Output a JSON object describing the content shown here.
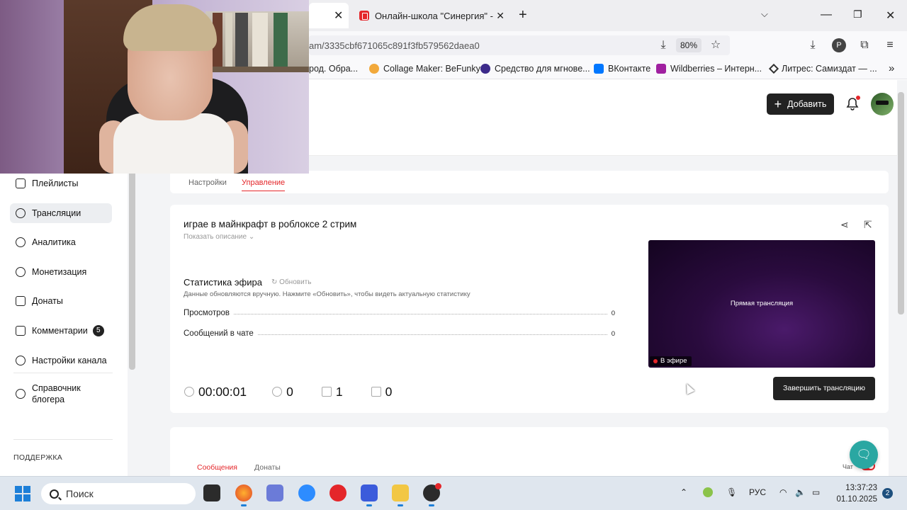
{
  "browser": {
    "tab_title": "Онлайн-школа \"Синергия\" - д",
    "url": "am/3335cbf671065c891f3fb579562daea0",
    "zoom": "80%",
    "bookmarks": [
      "род. Обра...",
      "Collage Maker: BeFunky",
      "Средство для мгнове...",
      "ВКонтакте",
      "Wildberries – Интерн...",
      "Литрес: Самиздат — ..."
    ]
  },
  "header": {
    "add_label": "Добавить"
  },
  "sidebar": {
    "items": [
      {
        "label": "Плейлисты",
        "icon": "playlist-icon"
      },
      {
        "label": "Трансляции",
        "icon": "broadcast-icon"
      },
      {
        "label": "Аналитика",
        "icon": "analytics-icon"
      },
      {
        "label": "Монетизация",
        "icon": "ruble-icon"
      },
      {
        "label": "Донаты",
        "icon": "donate-icon"
      },
      {
        "label": "Комментарии",
        "icon": "comments-icon",
        "badge": "5"
      },
      {
        "label": "Настройки канала",
        "icon": "settings-icon"
      },
      {
        "label": "Справочник\nблогера",
        "icon": "help-icon"
      }
    ],
    "support_label": "ПОДДЕРЖКА"
  },
  "page_tabs": [
    "Настройки",
    "Управление"
  ],
  "stream": {
    "title": "играе в майнкрафт в роблоксе 2 стрим",
    "show_description": "Показать описание",
    "stats_title": "Статистика эфира",
    "refresh_label": "Обновить",
    "stats_note": "Данные обновляются вручную. Нажмите «Обновить», чтобы видеть актуальную статистику",
    "stats": [
      {
        "label": "Просмотров",
        "value": "0"
      },
      {
        "label": "Сообщений в чате",
        "value": "0"
      }
    ],
    "timer": "00:00:01",
    "viewers": "0",
    "likes": "1",
    "dislikes": "0",
    "preview_label": "Прямая трансляция",
    "on_air": "В эфире",
    "end_button": "Завершить трансляцию"
  },
  "chat": {
    "tabs": [
      "Сообщения",
      "Донаты"
    ],
    "chat_label": "Чат"
  },
  "taskbar": {
    "search_placeholder": "Поиск",
    "lang": "РУС",
    "time": "13:37:23",
    "date": "01.10.2025",
    "notifications": "2"
  },
  "colors": {
    "accent": "#e4262a",
    "dark_button": "#222222",
    "help_fab": "#2aa7a2"
  }
}
